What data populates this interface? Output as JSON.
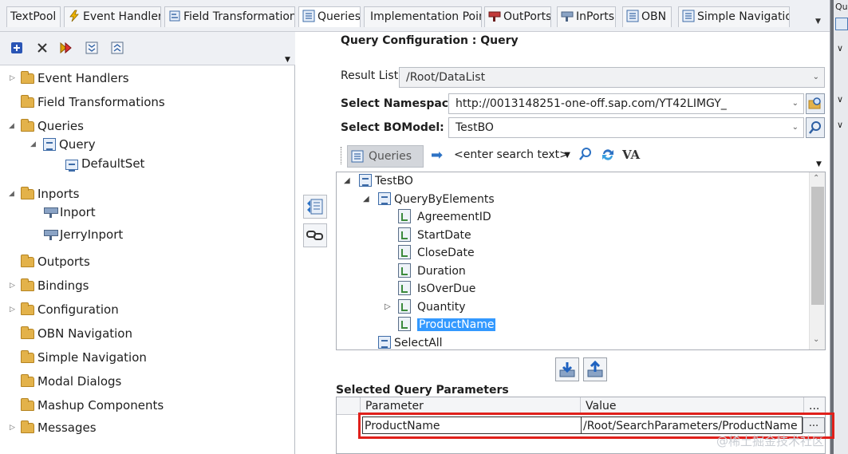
{
  "tabs": [
    {
      "label": "TextPool",
      "icon": "none"
    },
    {
      "label": "Event Handlers",
      "icon": "lightning-icon"
    },
    {
      "label": "Field Transformations",
      "icon": "transform-icon"
    },
    {
      "label": "Queries",
      "icon": "query-icon"
    },
    {
      "label": "Implementation Points",
      "icon": "none"
    },
    {
      "label": "OutPorts",
      "icon": "outport-icon"
    },
    {
      "label": "InPorts",
      "icon": "inport-icon"
    },
    {
      "label": "OBN",
      "icon": "obn-icon"
    },
    {
      "label": "Simple Navigation",
      "icon": "navigation-icon"
    }
  ],
  "right_strip": {
    "label": "Qu"
  },
  "tree": {
    "items": [
      {
        "label": "Event Handlers"
      },
      {
        "label": "Field Transformations"
      },
      {
        "label": "Queries"
      },
      {
        "label": "Query"
      },
      {
        "label": "DefaultSet"
      },
      {
        "label": "Inports"
      },
      {
        "label": "Inport"
      },
      {
        "label": "JerryInport"
      },
      {
        "label": "Outports"
      },
      {
        "label": "Bindings"
      },
      {
        "label": "Configuration"
      },
      {
        "label": "OBN Navigation"
      },
      {
        "label": "Simple Navigation"
      },
      {
        "label": "Modal Dialogs"
      },
      {
        "label": "Mashup Components"
      },
      {
        "label": "Messages"
      }
    ]
  },
  "config": {
    "title": "Query Configuration : Query",
    "result_list_label": "Result List",
    "result_list_value": "/Root/DataList",
    "namespace_label": "Select Namespace:",
    "namespace_value": "http://0013148251-one-off.sap.com/YT42LIMGY_",
    "bomodel_label": "Select BOModel:",
    "bomodel_value": "TestBO"
  },
  "search_toolbar": {
    "queries_label": "Queries",
    "search_placeholder": "<enter search text>",
    "va_label": "VA"
  },
  "query_tree": {
    "root": "TestBO",
    "query": "QueryByElements",
    "fields": [
      "AgreementID",
      "StartDate",
      "CloseDate",
      "Duration",
      "IsOverDue",
      "Quantity",
      "ProductName"
    ],
    "selected_field": "ProductName",
    "next": "SelectAll"
  },
  "selected_params": {
    "title": "Selected Query Parameters",
    "headers": {
      "parameter": "Parameter",
      "value": "Value",
      "more": "..."
    },
    "rows": [
      {
        "parameter": "ProductName",
        "value": "/Root/SearchParameters/ProductName",
        "button": "..."
      }
    ]
  },
  "watermark": "@稀土掘金技术社区",
  "colors": {
    "selection": "#3399ff",
    "highlight_box": "#e0201b",
    "folder": "#e3b24a"
  }
}
